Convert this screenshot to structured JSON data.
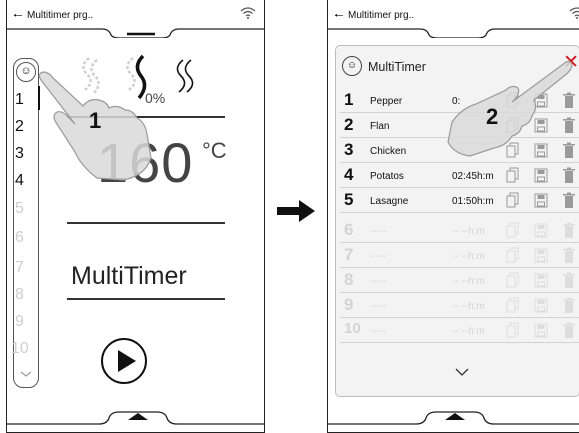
{
  "left_screen": {
    "title": "Multitimer prg..",
    "percent": "0%",
    "temperature": "160",
    "temp_unit": "°C",
    "program_label": "MultiTimer",
    "step": "1",
    "numbers": [
      {
        "label": "1",
        "active": true
      },
      {
        "label": "2",
        "active": true
      },
      {
        "label": "3",
        "active": true
      },
      {
        "label": "4",
        "active": true
      },
      {
        "label": "5",
        "active": false
      },
      {
        "label": "6",
        "active": false
      },
      {
        "label": "7",
        "active": false
      },
      {
        "label": "8",
        "active": false
      },
      {
        "label": "9",
        "active": false
      },
      {
        "label": "10",
        "active": false
      }
    ]
  },
  "right_screen": {
    "title": "Multitimer prg..",
    "panel_title": "MultiTimer",
    "step": "2",
    "rows": [
      {
        "num": "1",
        "name": "Pepper",
        "time": "0:",
        "active": true
      },
      {
        "num": "2",
        "name": "Flan",
        "time": "",
        "active": true
      },
      {
        "num": "3",
        "name": "Chicken",
        "time": "",
        "active": true
      },
      {
        "num": "4",
        "name": "Potatos",
        "time": "02:45h:m",
        "active": true
      },
      {
        "num": "5",
        "name": "Lasagne",
        "time": "01:50h:m",
        "active": true
      },
      {
        "num": "6",
        "name": "-----",
        "time": "-- --h:m",
        "active": false
      },
      {
        "num": "7",
        "name": "-----",
        "time": "-- --h:m",
        "active": false
      },
      {
        "num": "8",
        "name": "-----",
        "time": "-- --h:m",
        "active": false
      },
      {
        "num": "9",
        "name": "-----",
        "time": "-- --h:m",
        "active": false
      },
      {
        "num": "10",
        "name": "-----",
        "time": "-- --h:m",
        "active": false
      }
    ]
  },
  "icons": {
    "back": "arrow-left-icon",
    "wifi": "wifi-icon",
    "steam": "steam-icon",
    "play": "play-icon",
    "copy": "copy-icon",
    "save": "save-icon",
    "delete": "trash-icon",
    "close": "close-icon",
    "chevron": "chevron-down-icon",
    "flow": "arrow-right-icon",
    "hand": "hand-pointer-icon"
  },
  "colors": {
    "close": "#d0161d",
    "panel": "#f3f3f3",
    "inactive": "#cfcfcf"
  }
}
